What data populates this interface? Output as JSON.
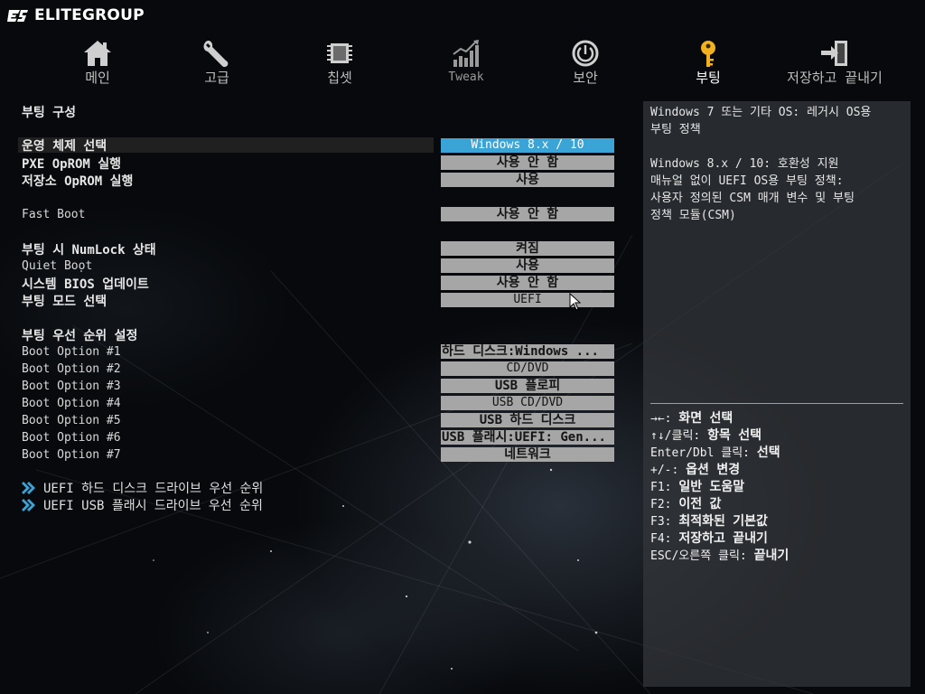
{
  "brand": {
    "name": "ELITEGROUP"
  },
  "nav": {
    "items": [
      {
        "label": "메인",
        "icon": "home-icon"
      },
      {
        "label": "고급",
        "icon": "wrench-icon"
      },
      {
        "label": "칩셋",
        "icon": "chip-icon"
      },
      {
        "label": "Tweak",
        "icon": "chart-icon"
      },
      {
        "label": "보안",
        "icon": "power-lock-icon"
      },
      {
        "label": "부팅",
        "icon": "key-icon",
        "active": true
      },
      {
        "label": "저장하고 끝내기",
        "icon": "exit-door-icon"
      }
    ]
  },
  "boot": {
    "section_title": "부팅 구성",
    "os_select": {
      "label": "운영 체제 선택",
      "value": "Windows 8.x / 10"
    },
    "pxe": {
      "label": "PXE OpROM 실행",
      "value": "사용 안 함"
    },
    "storage": {
      "label": "저장소 OpROM 실행",
      "value": "사용"
    },
    "fastboot": {
      "label": "Fast Boot",
      "value": "사용 안 함"
    },
    "numlock": {
      "label": "부팅 시 NumLock 상태",
      "value": "켜짐"
    },
    "quietboot": {
      "label": "Quiet Boot",
      "value": "사용"
    },
    "bios_update": {
      "label": "시스템 BIOS 업데이트",
      "value": "사용 안 함"
    },
    "boot_mode": {
      "label": "부팅 모드 선택",
      "value": "UEFI"
    },
    "priority_title": "부팅 우선 순위 설정",
    "options": [
      {
        "label": "Boot Option #1",
        "value": "하드 디스크:Windows ..."
      },
      {
        "label": "Boot Option #2",
        "value": "CD/DVD"
      },
      {
        "label": "Boot Option #3",
        "value": "USB 플로피"
      },
      {
        "label": "Boot Option #4",
        "value": "USB CD/DVD"
      },
      {
        "label": "Boot Option #5",
        "value": "USB 하드 디스크"
      },
      {
        "label": "Boot Option #6",
        "value": "USB 플래시:UEFI: Gen..."
      },
      {
        "label": "Boot Option #7",
        "value": "네트워크"
      }
    ],
    "links": [
      {
        "label": "UEFI 하드 디스크 드라이브 우선 순위"
      },
      {
        "label": "UEFI USB 플래시 드라이브 우선 순위"
      }
    ]
  },
  "help": {
    "lines": [
      "Windows 7 또는 기타 OS: 레거시 OS용",
      "부팅 정책",
      "",
      "Windows 8.x / 10: 호환성 지원",
      "매뉴얼 없이 UEFI OS용 부팅 정책:",
      "사용자 정의된 CSM 매개 변수 및 부팅",
      "정책 모듈(CSM)"
    ],
    "keys": [
      {
        "key": "→←:",
        "desc": "화면 선택"
      },
      {
        "key": "↑↓/클릭:",
        "desc": "항목 선택"
      },
      {
        "key": "Enter/Dbl 클릭:",
        "desc": "선택"
      },
      {
        "key": "+/-:",
        "desc": "옵션 변경"
      },
      {
        "key": "F1:",
        "desc": "일반 도움말"
      },
      {
        "key": "F2:",
        "desc": "이전 값"
      },
      {
        "key": "F3:",
        "desc": "최적화된 기본값"
      },
      {
        "key": "F4:",
        "desc": "저장하고 끝내기"
      },
      {
        "key": "ESC/오른쪽 클릭:",
        "desc": "끝내기"
      }
    ]
  },
  "colors": {
    "accent": "#3aa4d6",
    "highlight_text": "#2fb3e6",
    "value_bg": "#a6a6a6"
  }
}
